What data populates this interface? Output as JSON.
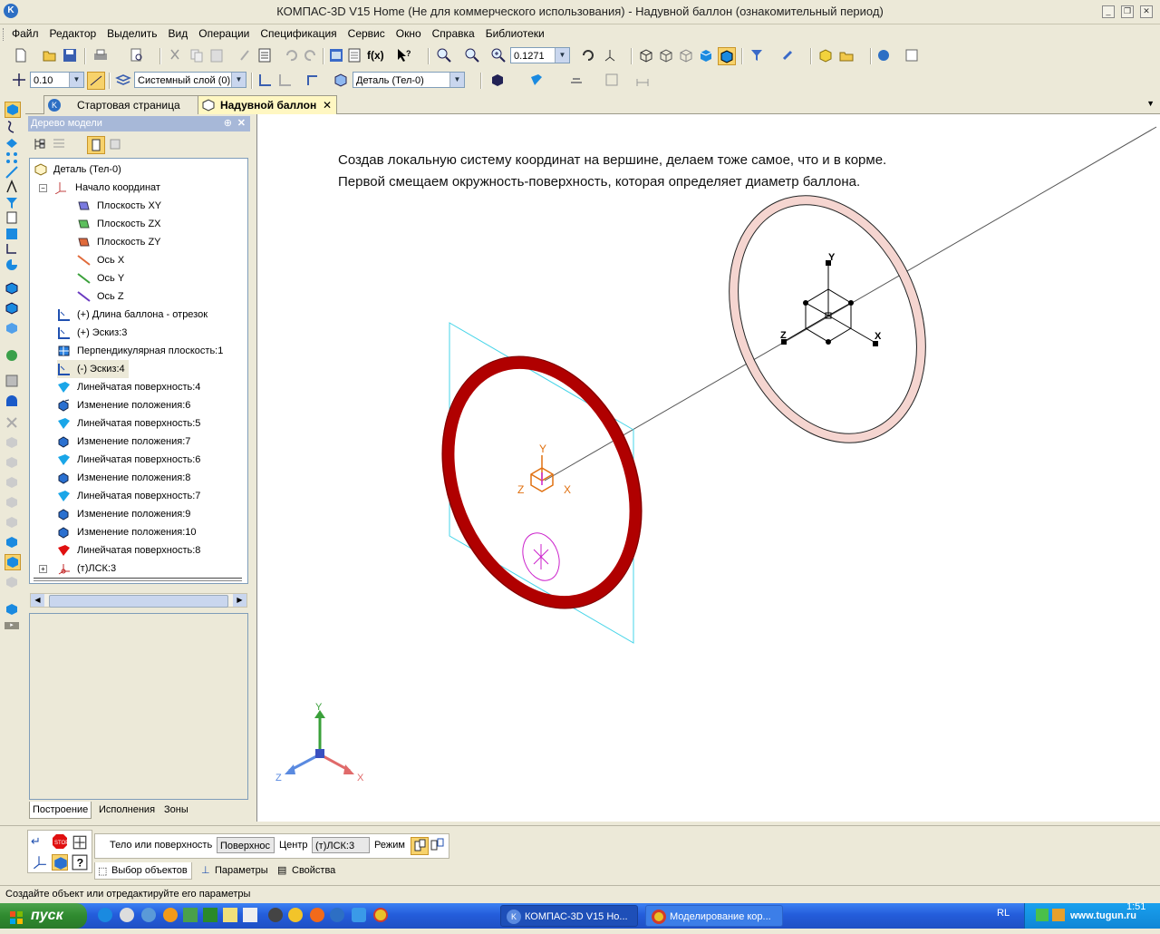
{
  "window": {
    "title": "КОМПАС-3D V15 Home (Не для коммерческого использования) - Надувной баллон (ознакомительный период)",
    "logo": "K"
  },
  "menu": [
    "Файл",
    "Редактор",
    "Выделить",
    "Вид",
    "Операции",
    "Спецификация",
    "Сервис",
    "Окно",
    "Справка",
    "Библиотеки"
  ],
  "toolbar1": {
    "zoom_value": "0.1271"
  },
  "toolbar2": {
    "step_value": "0.10",
    "layer_value": "Системный слой (0)",
    "detail_value": "Деталь (Тел-0)"
  },
  "tabs": [
    {
      "label": "Стартовая страница",
      "active": false
    },
    {
      "label": "Надувной баллон",
      "active": true
    }
  ],
  "tree": {
    "header": "Дерево модели",
    "items": [
      {
        "label": "Деталь (Тел-0)",
        "icon": "part-icon"
      },
      {
        "label": "Начало координат",
        "icon": "origin-icon"
      },
      {
        "label": "Плоскость XY",
        "icon": "plane-xy-icon"
      },
      {
        "label": "Плоскость ZX",
        "icon": "plane-zx-icon"
      },
      {
        "label": "Плоскость ZY",
        "icon": "plane-zy-icon"
      },
      {
        "label": "Ось X",
        "icon": "axis-x-icon"
      },
      {
        "label": "Ось Y",
        "icon": "axis-y-icon"
      },
      {
        "label": "Ось Z",
        "icon": "axis-z-icon"
      },
      {
        "label": "(+) Длина баллона - отрезок",
        "icon": "sketch-icon"
      },
      {
        "label": "(+) Эскиз:3",
        "icon": "sketch-icon"
      },
      {
        "label": "Перпендикулярная плоскость:1",
        "icon": "plane-icon"
      },
      {
        "label": "(-) Эскиз:4",
        "icon": "sketch-icon"
      },
      {
        "label": "Линейчатая поверхность:4",
        "icon": "ruled-surface-icon"
      },
      {
        "label": "Изменение положения:6",
        "icon": "move-icon"
      },
      {
        "label": "Линейчатая поверхность:5",
        "icon": "ruled-surface-icon"
      },
      {
        "label": "Изменение положения:7",
        "icon": "move-icon"
      },
      {
        "label": "Линейчатая поверхность:6",
        "icon": "ruled-surface-icon"
      },
      {
        "label": "Изменение положения:8",
        "icon": "move-icon"
      },
      {
        "label": "Линейчатая поверхность:7",
        "icon": "ruled-surface-icon"
      },
      {
        "label": "Изменение положения:9",
        "icon": "move-icon"
      },
      {
        "label": "Изменение положения:10",
        "icon": "move-icon"
      },
      {
        "label": "Линейчатая поверхность:8",
        "icon": "ruled-surface-icon"
      },
      {
        "label": "(т)ЛСК:3",
        "icon": "lcs-icon"
      }
    ],
    "bottom_tabs": [
      "Построение",
      "Исполнения",
      "Зоны"
    ]
  },
  "canvas": {
    "caption_line1": "Создав локальную систему координат на вершине, делаем тоже самое, что и в корме.",
    "caption_line2": "Первой смещаем окружность-поверхность, которая определяет диаметр баллона.",
    "axis_x": "X",
    "axis_y": "Y",
    "axis_z": "Z",
    "colors": {
      "ring_red": "#b00000",
      "ring_pink": "#f5d5d0",
      "plane_cyan": "#44d4e8",
      "lcs_orange": "#e07010",
      "sketch_magenta": "#cc22cc"
    }
  },
  "propbar": {
    "label_body": "Тело или поверхность",
    "value_body": "Поверхнос",
    "label_center": "Центр",
    "value_center": "(т)ЛСК:3",
    "label_mode": "Режим",
    "tabs": [
      "Выбор объектов",
      "Параметры",
      "Свойства"
    ]
  },
  "status": "Создайте объект или отредактируйте его параметры",
  "taskbar": {
    "start": "пуск",
    "items": [
      "КОМПАС-3D V15 Ho...",
      "Моделирование кор..."
    ],
    "lang": "RL",
    "clock": "1:51",
    "watermark": "www.tugun.ru"
  }
}
